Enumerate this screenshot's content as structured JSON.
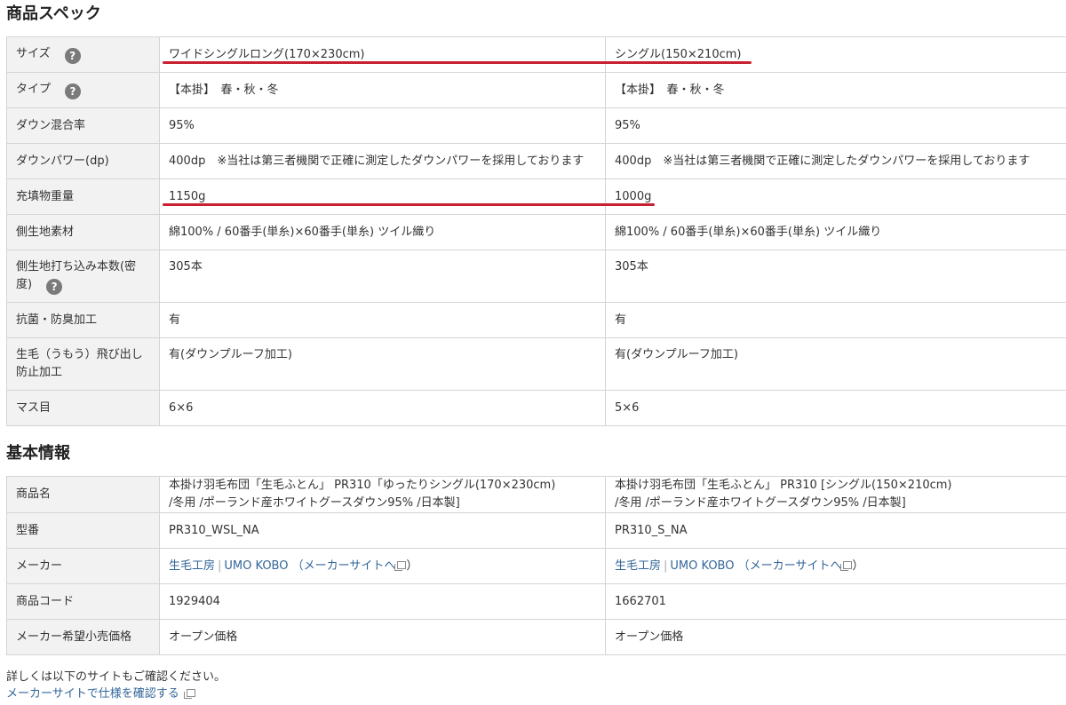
{
  "spec": {
    "title": "商品スペック",
    "rows": [
      {
        "label": "サイズ",
        "help": true,
        "v1": "ワイドシングルロング(170×230cm)",
        "v2": "シングル(150×210cm)"
      },
      {
        "label": "タイプ",
        "help": true,
        "v1": "【本掛】　春・秋・冬",
        "v2": "【本掛】　春・秋・冬"
      },
      {
        "label": "ダウン混合率",
        "v1": "95%",
        "v2": "95%"
      },
      {
        "label": "ダウンパワー(dp)",
        "v1": "400dp　※当社は第三者機関で正確に測定したダウンパワーを採用しております",
        "v2": "400dp　※当社は第三者機関で正確に測定したダウンパワーを採用しております"
      },
      {
        "label": "充填物重量",
        "v1": "1150g",
        "v2": "1000g"
      },
      {
        "label": "側生地素材",
        "v1": "綿100% / 60番手(単糸)×60番手(単糸) ツイル織り",
        "v2": "綿100% / 60番手(単糸)×60番手(単糸) ツイル織り"
      },
      {
        "label_a": "側生地打ち込み本数(密",
        "label_b": "度)",
        "help": true,
        "v1": "305本",
        "v2": "305本"
      },
      {
        "label": "抗菌・防臭加工",
        "v1": "有",
        "v2": "有"
      },
      {
        "label_a": "生毛（うもう）飛び出し",
        "label_b": "防止加工",
        "v1": "有(ダウンプルーフ加工)",
        "v2": "有(ダウンプルーフ加工)"
      },
      {
        "label": "マス目",
        "v1": "6×6",
        "v2": "5×6"
      }
    ]
  },
  "basic": {
    "title": "基本情報",
    "rows": [
      {
        "label": "商品名",
        "v1a": "本掛け羽毛布団「生毛ふとん」 PR310「ゆったりシングル(170×230cm)",
        "v1b": "/冬用 /ポーランド産ホワイトグースダウン95% /日本製]",
        "v2a": "本掛け羽毛布団「生毛ふとん」 PR310 [シングル(150×210cm)",
        "v2b": "/冬用 /ポーランド産ホワイトグースダウン95% /日本製]"
      },
      {
        "label": "型番",
        "v1": "PR310_WSL_NA",
        "v2": "PR310_S_NA"
      },
      {
        "label": "メーカー",
        "maker1": "生毛工房",
        "sep": "|",
        "maker2": "UMO KOBO",
        "maker_site": "（メーカーサイトへ"
      },
      {
        "label": "商品コード",
        "v1": "1929404",
        "v2": "1662701"
      },
      {
        "label": "メーカー希望小売価格",
        "v1": "オープン価格",
        "v2": "オープン価格"
      }
    ]
  },
  "footer": {
    "note": "詳しくは以下のサイトもご確認ください。",
    "link": "メーカーサイトで仕様を確認する",
    "maker_site_close": "）"
  },
  "icons": {
    "help": "question-circle-icon",
    "external": "external-link-icon"
  },
  "colors": {
    "highlight": "#c8202e",
    "link": "#336699",
    "label_bg": "#f2f2f2"
  }
}
